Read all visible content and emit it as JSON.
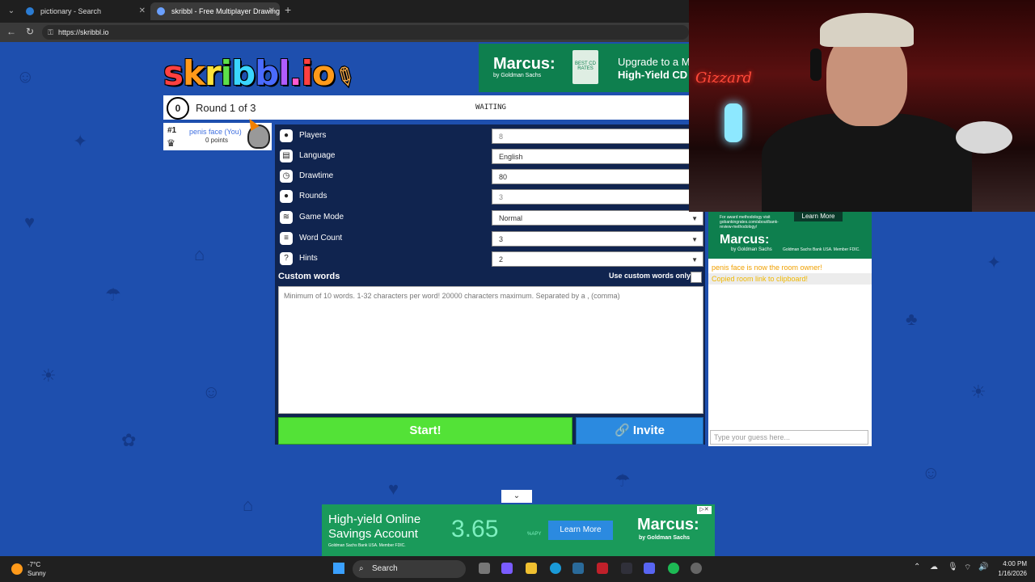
{
  "browser": {
    "tabs": [
      {
        "label": "pictionary - Search"
      },
      {
        "label": "skribbl - Free Multiplayer Drawing"
      }
    ],
    "url": "https://skribbl.io"
  },
  "game": {
    "logo": [
      "s",
      "k",
      "r",
      "i",
      "b",
      "b",
      "l",
      ".",
      "i",
      "o"
    ],
    "clock": "0",
    "round": "Round 1 of 3",
    "status": "WAITING",
    "player": {
      "rank": "#1",
      "name": "penis face (You)",
      "points": "0 points"
    },
    "settings": [
      {
        "label": "Players",
        "value": "8",
        "icon": "players-icon"
      },
      {
        "label": "Language",
        "value": "English",
        "icon": "language-icon"
      },
      {
        "label": "Drawtime",
        "value": "80",
        "icon": "drawtime-icon"
      },
      {
        "label": "Rounds",
        "value": "3",
        "icon": "rounds-icon"
      },
      {
        "label": "Game Mode",
        "value": "Normal",
        "icon": "game-mode-icon"
      },
      {
        "label": "Word Count",
        "value": "3",
        "icon": "word-count-icon"
      },
      {
        "label": "Hints",
        "value": "2",
        "icon": "hints-icon"
      }
    ],
    "custom_words_title": "Custom words",
    "custom_words_only": "Use custom words only",
    "custom_words_placeholder": "Minimum of 10 words. 1-32 characters per word! 20000 characters maximum. Separated by a , (comma)",
    "start_label": "Start!",
    "invite_label": "Invite"
  },
  "chat": {
    "ad": {
      "learn": "Learn More",
      "brand": "Marcus:",
      "by": "by Goldman Sachs",
      "fine": "For award methodology visit gobankingrates.com/about/bank-review-methodology/",
      "legal": "Goldman Sachs Bank USA. Member FDIC."
    },
    "messages": [
      {
        "text": "penis face is now the room owner!"
      },
      {
        "text": "Copied room link to clipboard!"
      }
    ],
    "guess_placeholder": "Type your guess here..."
  },
  "top_ad": {
    "brand": "Marcus:",
    "by": "by Goldman Sachs",
    "line1": "Upgrade to a M",
    "line2": "High-Yield CD",
    "badge": "BEST CD RATES"
  },
  "bottom_ad": {
    "headline": "High-yield Online Savings Account",
    "rate": "3.65",
    "apy": "%APY",
    "learn": "Learn More",
    "brand": "Marcus:",
    "by": "by Goldman Sachs",
    "fine": "Goldman Sachs Bank USA. Member FDIC."
  },
  "webcam": {
    "neon": "Gizzard"
  },
  "taskbar": {
    "temp": "-7°C",
    "condition": "Sunny",
    "search": "Search",
    "time": "4:00 PM",
    "date": "1/16/2026"
  }
}
